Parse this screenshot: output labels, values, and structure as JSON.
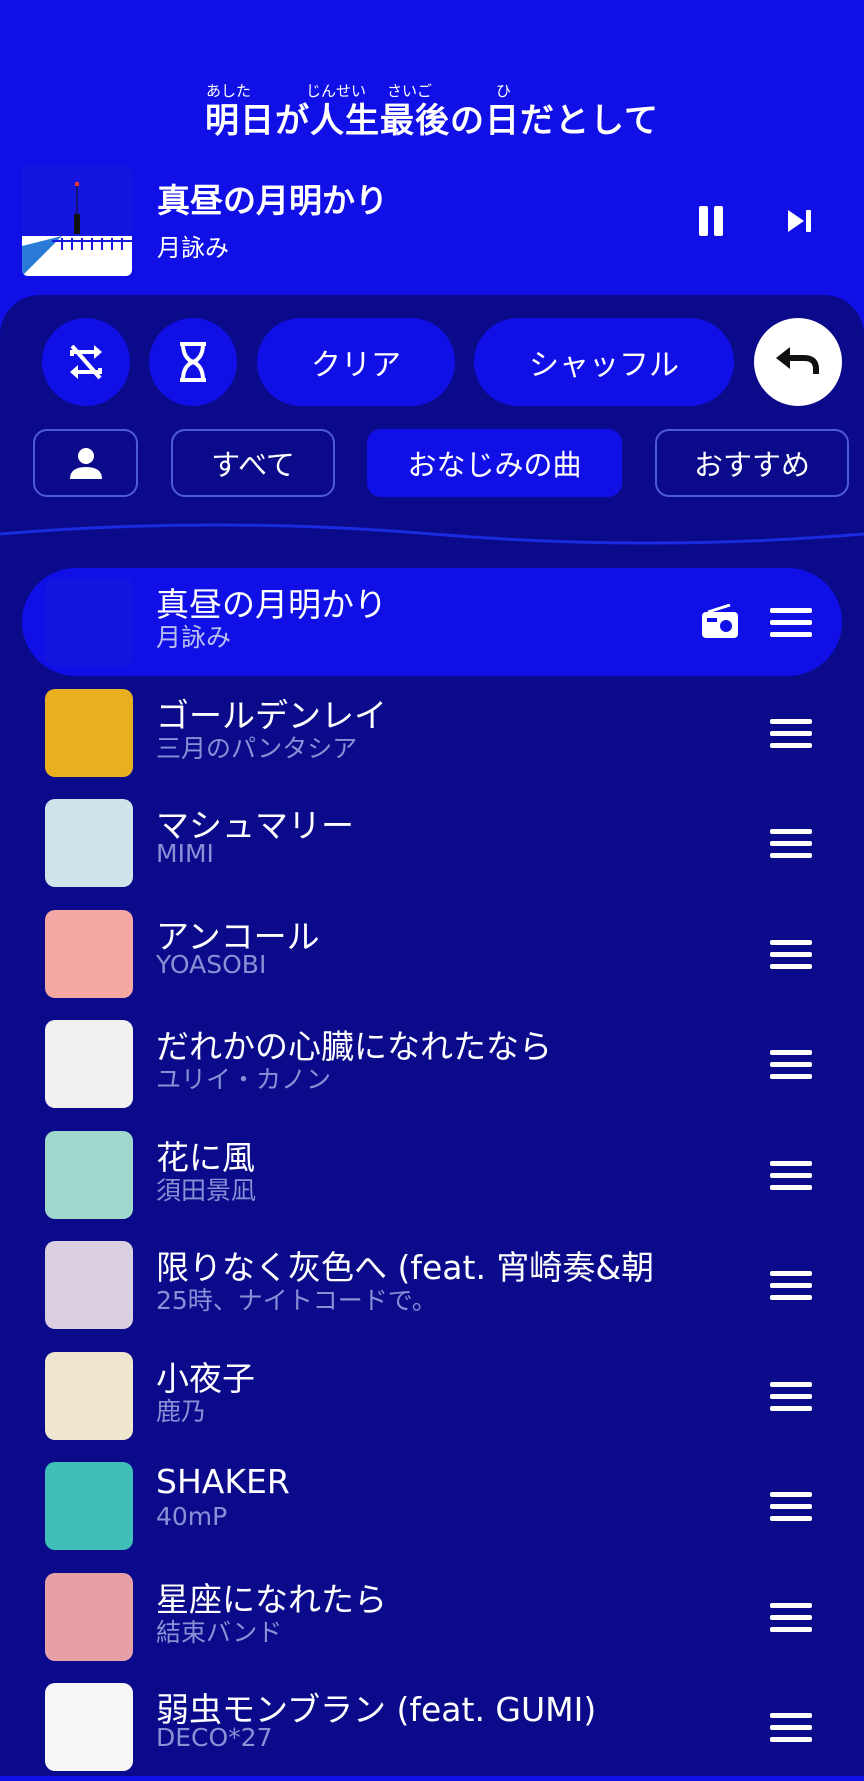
{
  "lyrics": {
    "ruby": [
      "あした",
      "じんせい",
      "さいご",
      "ひ"
    ],
    "line": "明日が人生最後の日だとして"
  },
  "now_playing": {
    "title": "真昼の月明かり",
    "artist": "月詠み"
  },
  "controls": {
    "clear_label": "クリア",
    "shuffle_label": "シャッフル"
  },
  "filters": {
    "all": "すべて",
    "familiar": "おなじみの曲",
    "recommended": "おすすめ",
    "active": "familiar"
  },
  "queue": [
    {
      "title": "真昼の月明かり",
      "artist": "月詠み",
      "current": true,
      "art": "#1515e0"
    },
    {
      "title": "ゴールデンレイ",
      "artist": "三月のパンタシア",
      "art": "#e8b020"
    },
    {
      "title": "マシュマリー",
      "artist": "MIMI",
      "art": "#cfe3ea"
    },
    {
      "title": "アンコール",
      "artist": "YOASOBI",
      "art": "#f4a7a3"
    },
    {
      "title": "だれかの心臓になれたなら",
      "artist": "ユリイ・カノン",
      "art": "#f2f0f0"
    },
    {
      "title": "花に風",
      "artist": "須田景凪",
      "art": "#9fd8cc"
    },
    {
      "title": "限りなく灰色へ (feat. 宵崎奏&朝",
      "artist": "25時、ナイトコードで。",
      "art": "#d9cfe0"
    },
    {
      "title": "小夜子",
      "artist": "鹿乃",
      "art": "#efe6d0"
    },
    {
      "title": "SHAKER",
      "artist": "40mP",
      "art": "#3fbfb8"
    },
    {
      "title": "星座になれたら",
      "artist": "結束バンド",
      "art": "#e8a0a8"
    },
    {
      "title": "弱虫モンブラン (feat. GUMI)",
      "artist": "DECO*27",
      "art": "#f6f6f6"
    }
  ]
}
